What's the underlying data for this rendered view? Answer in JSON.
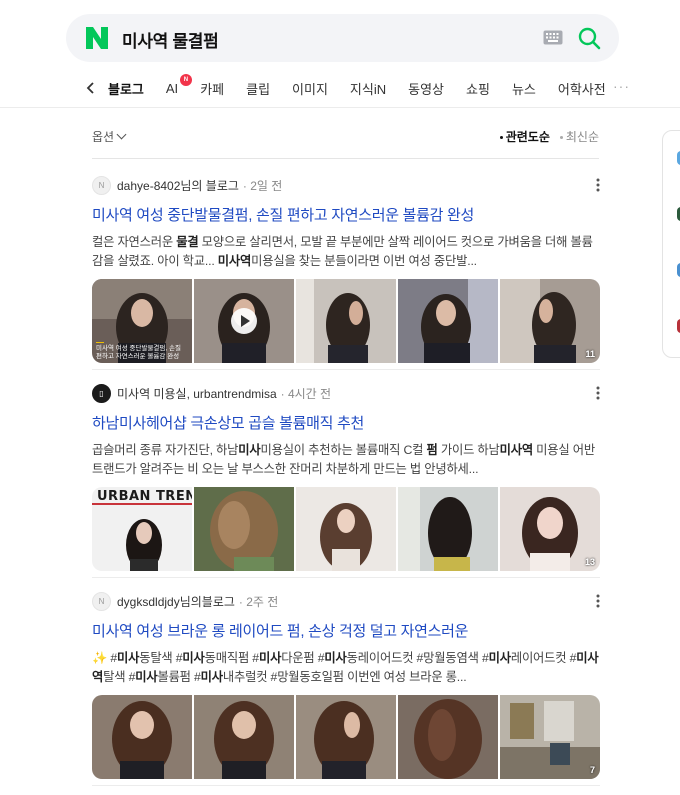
{
  "search": {
    "query": "미사역 물결펌"
  },
  "tabs": {
    "items": [
      "블로그",
      "AI",
      "카페",
      "클립",
      "이미지",
      "지식iN",
      "동영상",
      "쇼핑",
      "뉴스",
      "어학사전"
    ],
    "ai_badge": "N",
    "more": "···"
  },
  "sort": {
    "option_label": "옵션",
    "relevance": "관련도순",
    "recent": "최신순"
  },
  "colors": {
    "title": "#1f4ac2",
    "naver_green": "#03c75a",
    "badge_red": "#f2344a"
  },
  "results": [
    {
      "avatar_letter": "N",
      "source": "dahye-8402님의 블로그",
      "time": "· 2일 전",
      "title": "미사역 여성 중단발물결펌, 손질 편하고 자연스러운 볼륨감 완성",
      "snippet_html": "컬은 자연스러운 <b>물결</b> 모양으로 살리면서, 모발 끝 부분에만 살짝 레이어드 컷으로 가벼움을 더해 볼륨감을 살렸죠. 아이 학교... <b>미사역</b>미용실을 찾는 분들이라면 이번 여성 중단발...",
      "video_caption": "미사역 여성 중단발물결펌, 손질 편하고 자연스러운 볼륨감 완성",
      "image_count": "11"
    },
    {
      "avatar_letter": "",
      "source": "미사역 미용실, urbantrendmisa",
      "time": "· 4시간 전",
      "title": "하남미사헤어샵 극손상모 곱슬 볼륨매직 추천",
      "snippet_html": "곱슬머리 종류 자가진단, 하남<b>미사</b>미용실이 추천하는 볼륨매직 C컬 <b>펌</b> 가이드 하남<b>미사역</b> 미용실 어반트랜드가 알려주는 비 오는 날 부스스한 잔머리 차분하게 만드는 법 안녕하세...",
      "brand_text": "URBAN TREND",
      "image_count": "13"
    },
    {
      "avatar_letter": "N",
      "source": "dygksdldjdy님의블로그",
      "time": "· 2주 전",
      "title": "미사역 여성 브라운 롱 레이어드 펌, 손상 걱정 덜고 자연스러운",
      "snippet_html": "✨ #<b>미사</b>동탈색 #<b>미사</b>동매직펌 #<b>미사</b>다운펌 #<b>미사</b>동레이어드컷 #망월동염색 #<b>미사</b>레이어드컷 #<b>미사역</b>탈색 #<b>미사</b>볼륨펌 #<b>미사</b>내추럴컷 #망월동호일펌 이번엔 여성 브라운 롱...",
      "image_count": "7"
    }
  ]
}
